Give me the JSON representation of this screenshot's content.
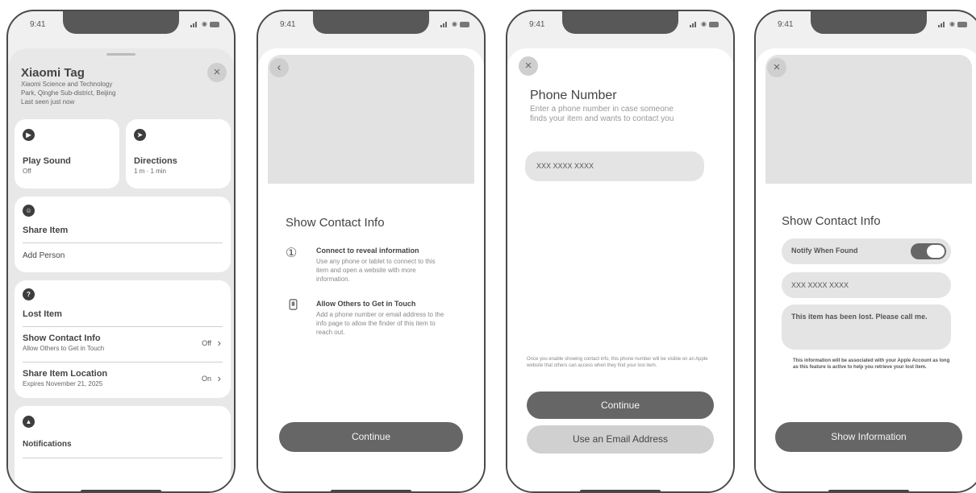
{
  "status_time": "9:41",
  "screen1": {
    "title": "Xiaomi Tag",
    "address_line1": "Xiaomi Science and Technology",
    "address_line2": "Park, Qinghe Sub-district, Beijing",
    "last_seen": "Last seen just now",
    "play_sound": {
      "label": "Play Sound",
      "value": "Off"
    },
    "directions": {
      "label": "Directions",
      "value": "1 m · 1 min"
    },
    "share_item": {
      "label": "Share Item",
      "add_person": "Add Person"
    },
    "lost_item": {
      "label": "Lost Item",
      "show_contact": {
        "label": "Show Contact Info",
        "sub": "Allow Others to Get in Touch",
        "value": "Off"
      },
      "share_location": {
        "label": "Share Item Location",
        "sub": "Expires November 21, 2025",
        "value": "On"
      }
    },
    "notifications": {
      "label": "Notifications"
    }
  },
  "screen2": {
    "heading": "Show Contact Info",
    "step1": {
      "title": "Connect to reveal information",
      "body": "Use any phone or tablet to connect to this item and open a website with more information."
    },
    "step2": {
      "title": "Allow Others to Get in Touch",
      "body": "Add a phone number or email address to the info page to allow the finder of this item to reach out."
    },
    "continue_label": "Continue"
  },
  "screen3": {
    "heading": "Phone Number",
    "subtitle": "Enter a phone number in case someone finds your item and wants to contact you",
    "phone_placeholder": "XXX XXXX XXXX",
    "disclaimer": "Once you enable showing contact info, this phone number will be visible on an Apple website that others can access when they find your lost item.",
    "continue_label": "Continue",
    "email_label": "Use an Email Address"
  },
  "screen4": {
    "heading": "Show Contact Info",
    "notify_label": "Notify When Found",
    "phone_value": "XXX XXXX XXXX",
    "message": "This item has been lost. Please call me.",
    "info": "This information will be associated with your Apple Account as long as this feature is active to help you retrieve your lost item.",
    "show_info_label": "Show Information"
  },
  "icons": {
    "close": "×",
    "back": "‹",
    "step1": "①",
    "chevron": "›"
  },
  "colors": {
    "button_dark": "#666666",
    "panel_bg": "#f0f0f0"
  }
}
